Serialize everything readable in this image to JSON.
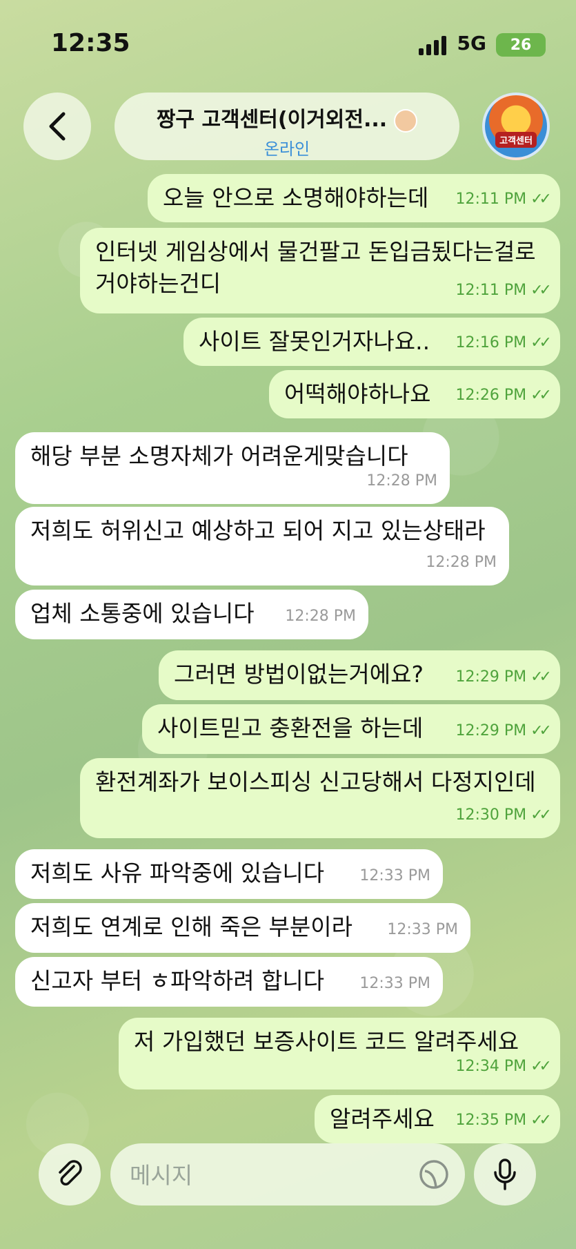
{
  "status_bar": {
    "time": "12:35",
    "network": "5G",
    "battery": "26"
  },
  "header": {
    "title": "짱구 고객센터(이거외전...",
    "status": "온라인",
    "avatar_text": "고객센터"
  },
  "messages": [
    {
      "dir": "out",
      "text": "오늘 안으로 소명해야하는데",
      "time": "12:11 PM"
    },
    {
      "dir": "out",
      "text": "인터넷 게임상에서 물건팔고 돈입금됬다는걸로 거야하는건디",
      "time": "12:11 PM"
    },
    {
      "dir": "out",
      "text": "사이트 잘못인거자나요..",
      "time": "12:16 PM"
    },
    {
      "dir": "out",
      "text": "어떡해야하나요",
      "time": "12:26 PM"
    },
    {
      "dir": "in",
      "text": "해당 부분 소명자체가 어려운게맞습니다",
      "time": "12:28 PM"
    },
    {
      "dir": "in",
      "text": "저희도 허위신고 예상하고 되어 지고 있는상태라",
      "time": "12:28 PM"
    },
    {
      "dir": "in",
      "text": "업체 소통중에 있습니다",
      "time": "12:28 PM"
    },
    {
      "dir": "out",
      "text": "그러면 방법이없는거에요?",
      "time": "12:29 PM"
    },
    {
      "dir": "out",
      "text": "사이트믿고 충환전을 하는데",
      "time": "12:29 PM"
    },
    {
      "dir": "out",
      "text": "환전계좌가 보이스피싱 신고당해서 다정지인데",
      "time": "12:30 PM"
    },
    {
      "dir": "in",
      "text": "저희도 사유 파악중에 있습니다",
      "time": "12:33 PM"
    },
    {
      "dir": "in",
      "text": "저희도 연계로 인해 죽은 부분이라",
      "time": "12:33 PM"
    },
    {
      "dir": "in",
      "text": "신고자 부터 ㅎ파악하려 합니다",
      "time": "12:33 PM"
    },
    {
      "dir": "out",
      "text": "저 가입했던 보증사이트 코드 알려주세요",
      "time": "12:34 PM"
    },
    {
      "dir": "out",
      "text": "알려주세요",
      "time": "12:35 PM"
    }
  ],
  "input": {
    "placeholder": "메시지",
    "value": ""
  },
  "colors": {
    "outgoing_bubble": "#e6fbc8",
    "incoming_bubble": "#ffffff",
    "time_out": "#4fa33c",
    "link": "#3b8fd8"
  },
  "icons": {
    "back": "chevron-left-icon",
    "attach": "paperclip-icon",
    "sticker": "sticker-icon",
    "mic": "microphone-icon",
    "read": "double-check-icon"
  }
}
